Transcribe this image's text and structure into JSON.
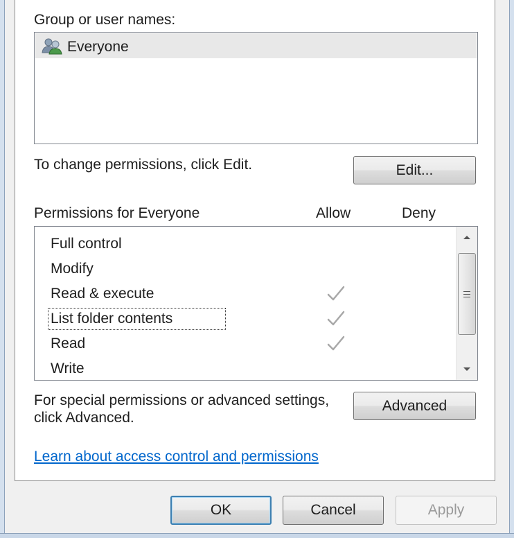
{
  "group_section": {
    "label": "Group or user names:",
    "items": [
      {
        "name": "Everyone",
        "icon": "user-group-icon",
        "selected": true
      }
    ]
  },
  "change_section": {
    "text": "To change permissions, click Edit.",
    "edit_button": "Edit..."
  },
  "permissions": {
    "header_label": "Permissions for Everyone",
    "allow_header": "Allow",
    "deny_header": "Deny",
    "rows": [
      {
        "name": "Full control",
        "allow": false,
        "deny": false
      },
      {
        "name": "Modify",
        "allow": false,
        "deny": false
      },
      {
        "name": "Read & execute",
        "allow": true,
        "deny": false
      },
      {
        "name": "List folder contents",
        "allow": true,
        "deny": false,
        "focused": true
      },
      {
        "name": "Read",
        "allow": true,
        "deny": false
      },
      {
        "name": "Write",
        "allow": false,
        "deny": false
      }
    ]
  },
  "advanced_section": {
    "text_line1": "For special permissions or advanced settings,",
    "text_line2": "click Advanced.",
    "advanced_button": "Advanced"
  },
  "learn_link": "Learn about access control and permissions",
  "dialog_buttons": {
    "ok": "OK",
    "cancel": "Cancel",
    "apply": "Apply",
    "apply_enabled": false
  },
  "colors": {
    "link": "#0066cc",
    "check_inherited": "#a8a8a8",
    "selection": "#e8e8e8",
    "default_button_border": "#3c7fb1"
  }
}
